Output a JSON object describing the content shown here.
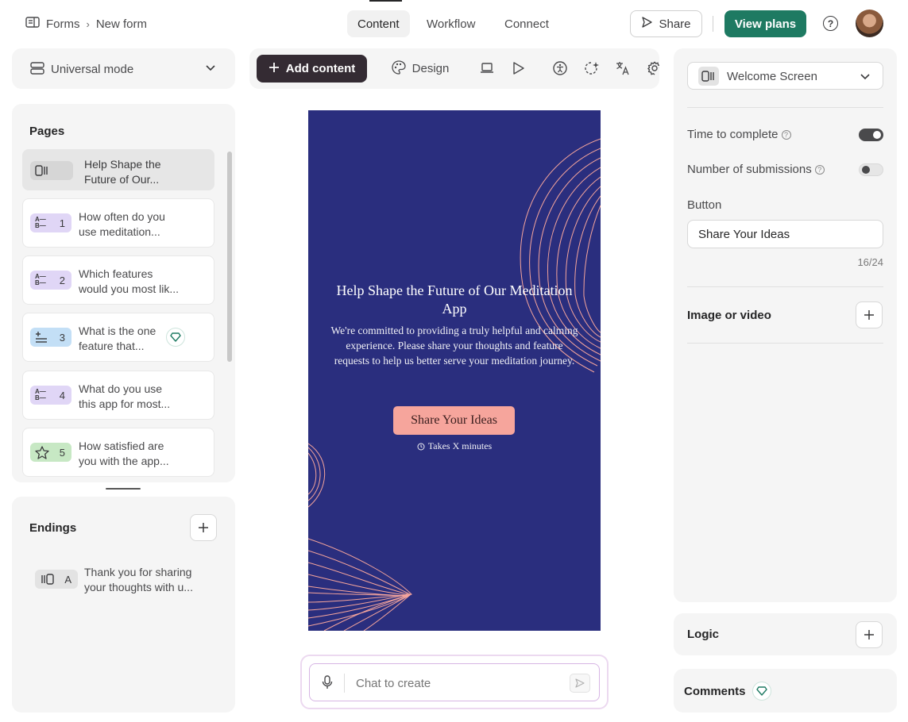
{
  "breadcrumb": {
    "root": "Forms",
    "current": "New form"
  },
  "nav_tabs": [
    {
      "label": "Content",
      "active": true
    },
    {
      "label": "Workflow",
      "active": false
    },
    {
      "label": "Connect",
      "active": false
    }
  ],
  "header_actions": {
    "share": "Share",
    "view_plans": "View plans"
  },
  "mode_selector": {
    "label": "Universal mode"
  },
  "toolbar": {
    "add_content": "Add content",
    "design": "Design"
  },
  "pages_panel": {
    "title": "Pages",
    "items": [
      {
        "number": "",
        "text_line1": "Help Shape the",
        "text_line2": "Future of Our...",
        "type": "welcome"
      },
      {
        "number": "1",
        "text_line1": "How often do you",
        "text_line2": "use meditation...",
        "type": "choice"
      },
      {
        "number": "2",
        "text_line1": "Which features",
        "text_line2": "would you most lik...",
        "type": "choice"
      },
      {
        "number": "3",
        "text_line1": "What is the one",
        "text_line2": "feature that...",
        "type": "text"
      },
      {
        "number": "4",
        "text_line1": "What do you use",
        "text_line2": "this app for most...",
        "type": "choice"
      },
      {
        "number": "5",
        "text_line1": "How satisfied are",
        "text_line2": "you with the app...",
        "type": "rating"
      }
    ]
  },
  "endings_panel": {
    "title": "Endings",
    "items": [
      {
        "letter": "A",
        "text_line1": "Thank you for sharing",
        "text_line2": "your thoughts with u..."
      }
    ]
  },
  "preview": {
    "title": "Help Shape the Future of Our Meditation App",
    "description": "We're committed to providing a truly helpful and calming experience. Please share your thoughts and feature requests to help us better serve your meditation journey.",
    "button_label": "Share Your Ideas",
    "time_note": "Takes X minutes",
    "bg_color": "#2a2e7e",
    "accent_color": "#f6a59c"
  },
  "chat": {
    "placeholder": "Chat to create"
  },
  "settings_panel": {
    "screen_selector": "Welcome Screen",
    "time_to_complete": {
      "label": "Time to complete",
      "on": true
    },
    "number_of_submissions": {
      "label": "Number of submissions",
      "on": false
    },
    "button_section": {
      "label": "Button",
      "value": "Share Your Ideas",
      "counter": "16/24"
    },
    "image_or_video": "Image or video"
  },
  "logic_panel": {
    "title": "Logic"
  },
  "comments_panel": {
    "title": "Comments"
  },
  "colors": {
    "primary_green": "#1e7a62",
    "dark_button": "#342b33"
  }
}
